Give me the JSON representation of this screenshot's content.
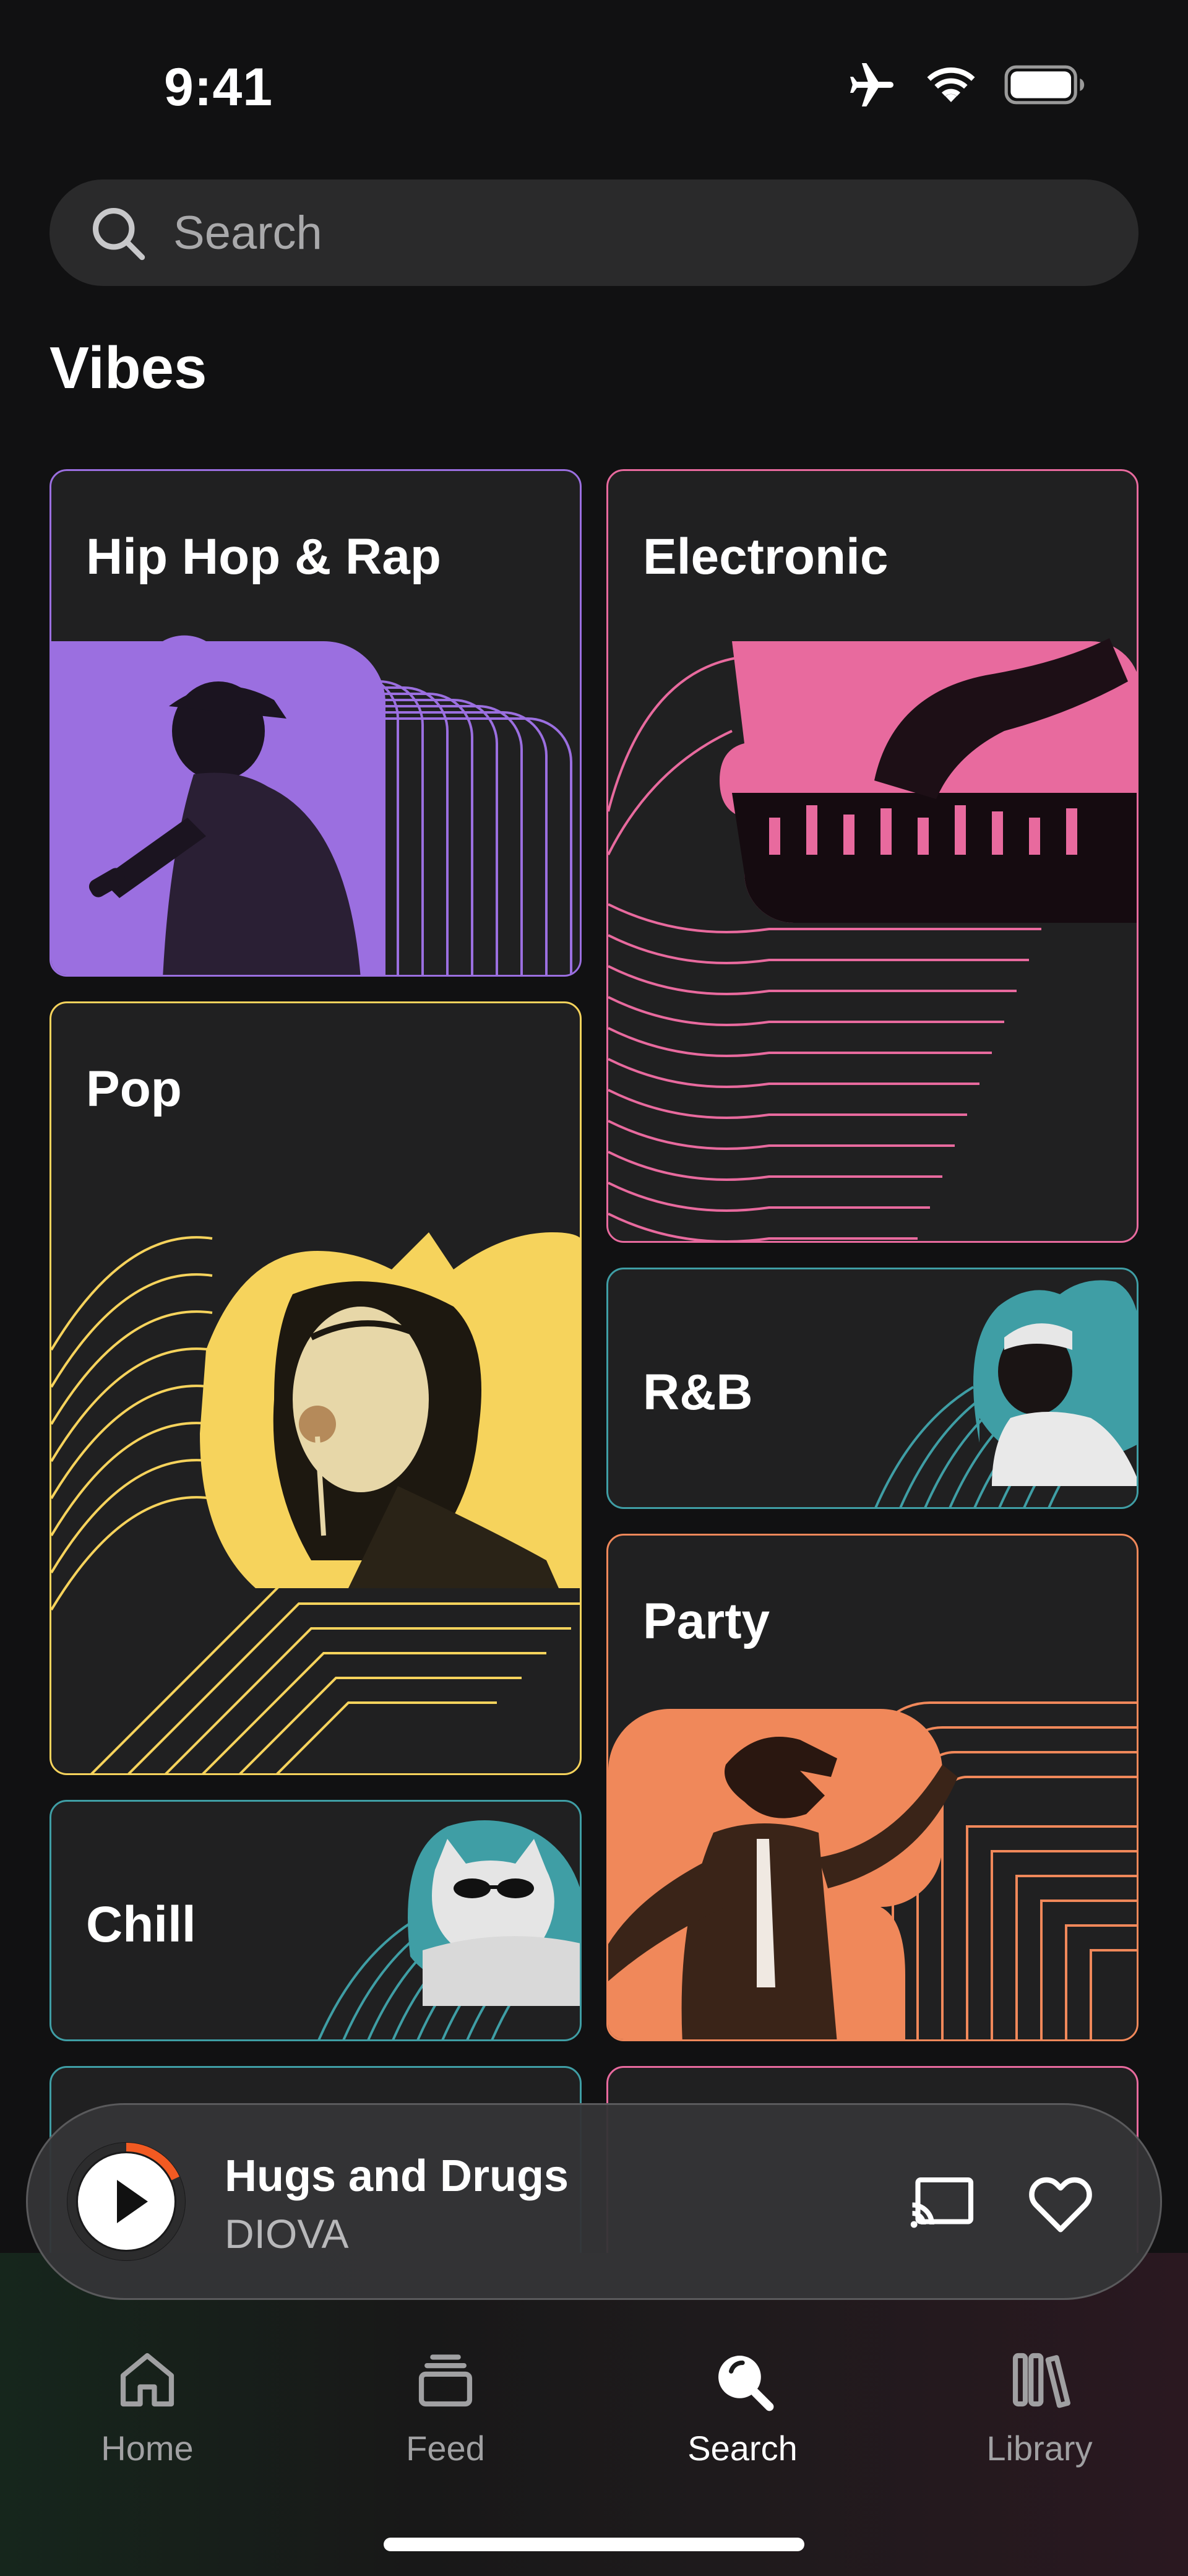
{
  "status": {
    "time": "9:41",
    "icons": [
      "airplane-icon",
      "wifi-icon",
      "battery-icon"
    ]
  },
  "search": {
    "placeholder": "Search",
    "icon": "search-icon"
  },
  "section": {
    "title": "Vibes"
  },
  "genres": [
    {
      "label": "Hip Hop & Rap",
      "accent": "#9b6fe0"
    },
    {
      "label": "Electronic",
      "accent": "#e86a9e"
    },
    {
      "label": "Pop",
      "accent": "#f6d35c"
    },
    {
      "label": "R&B",
      "accent": "#3f9ea5"
    },
    {
      "label": "Party",
      "accent": "#f0885a"
    },
    {
      "label": "Chill",
      "accent": "#3f9ea5"
    }
  ],
  "player": {
    "title": "Hugs and Drugs",
    "artist": "DIOVA",
    "progress": 0.18,
    "progress_color": "#f25a22",
    "icons": [
      "play-icon",
      "cast-icon",
      "heart-icon"
    ]
  },
  "tabs": [
    {
      "label": "Home",
      "icon": "home-icon",
      "active": false
    },
    {
      "label": "Feed",
      "icon": "feed-icon",
      "active": false
    },
    {
      "label": "Search",
      "icon": "search-icon",
      "active": true
    },
    {
      "label": "Library",
      "icon": "library-icon",
      "active": false
    }
  ]
}
